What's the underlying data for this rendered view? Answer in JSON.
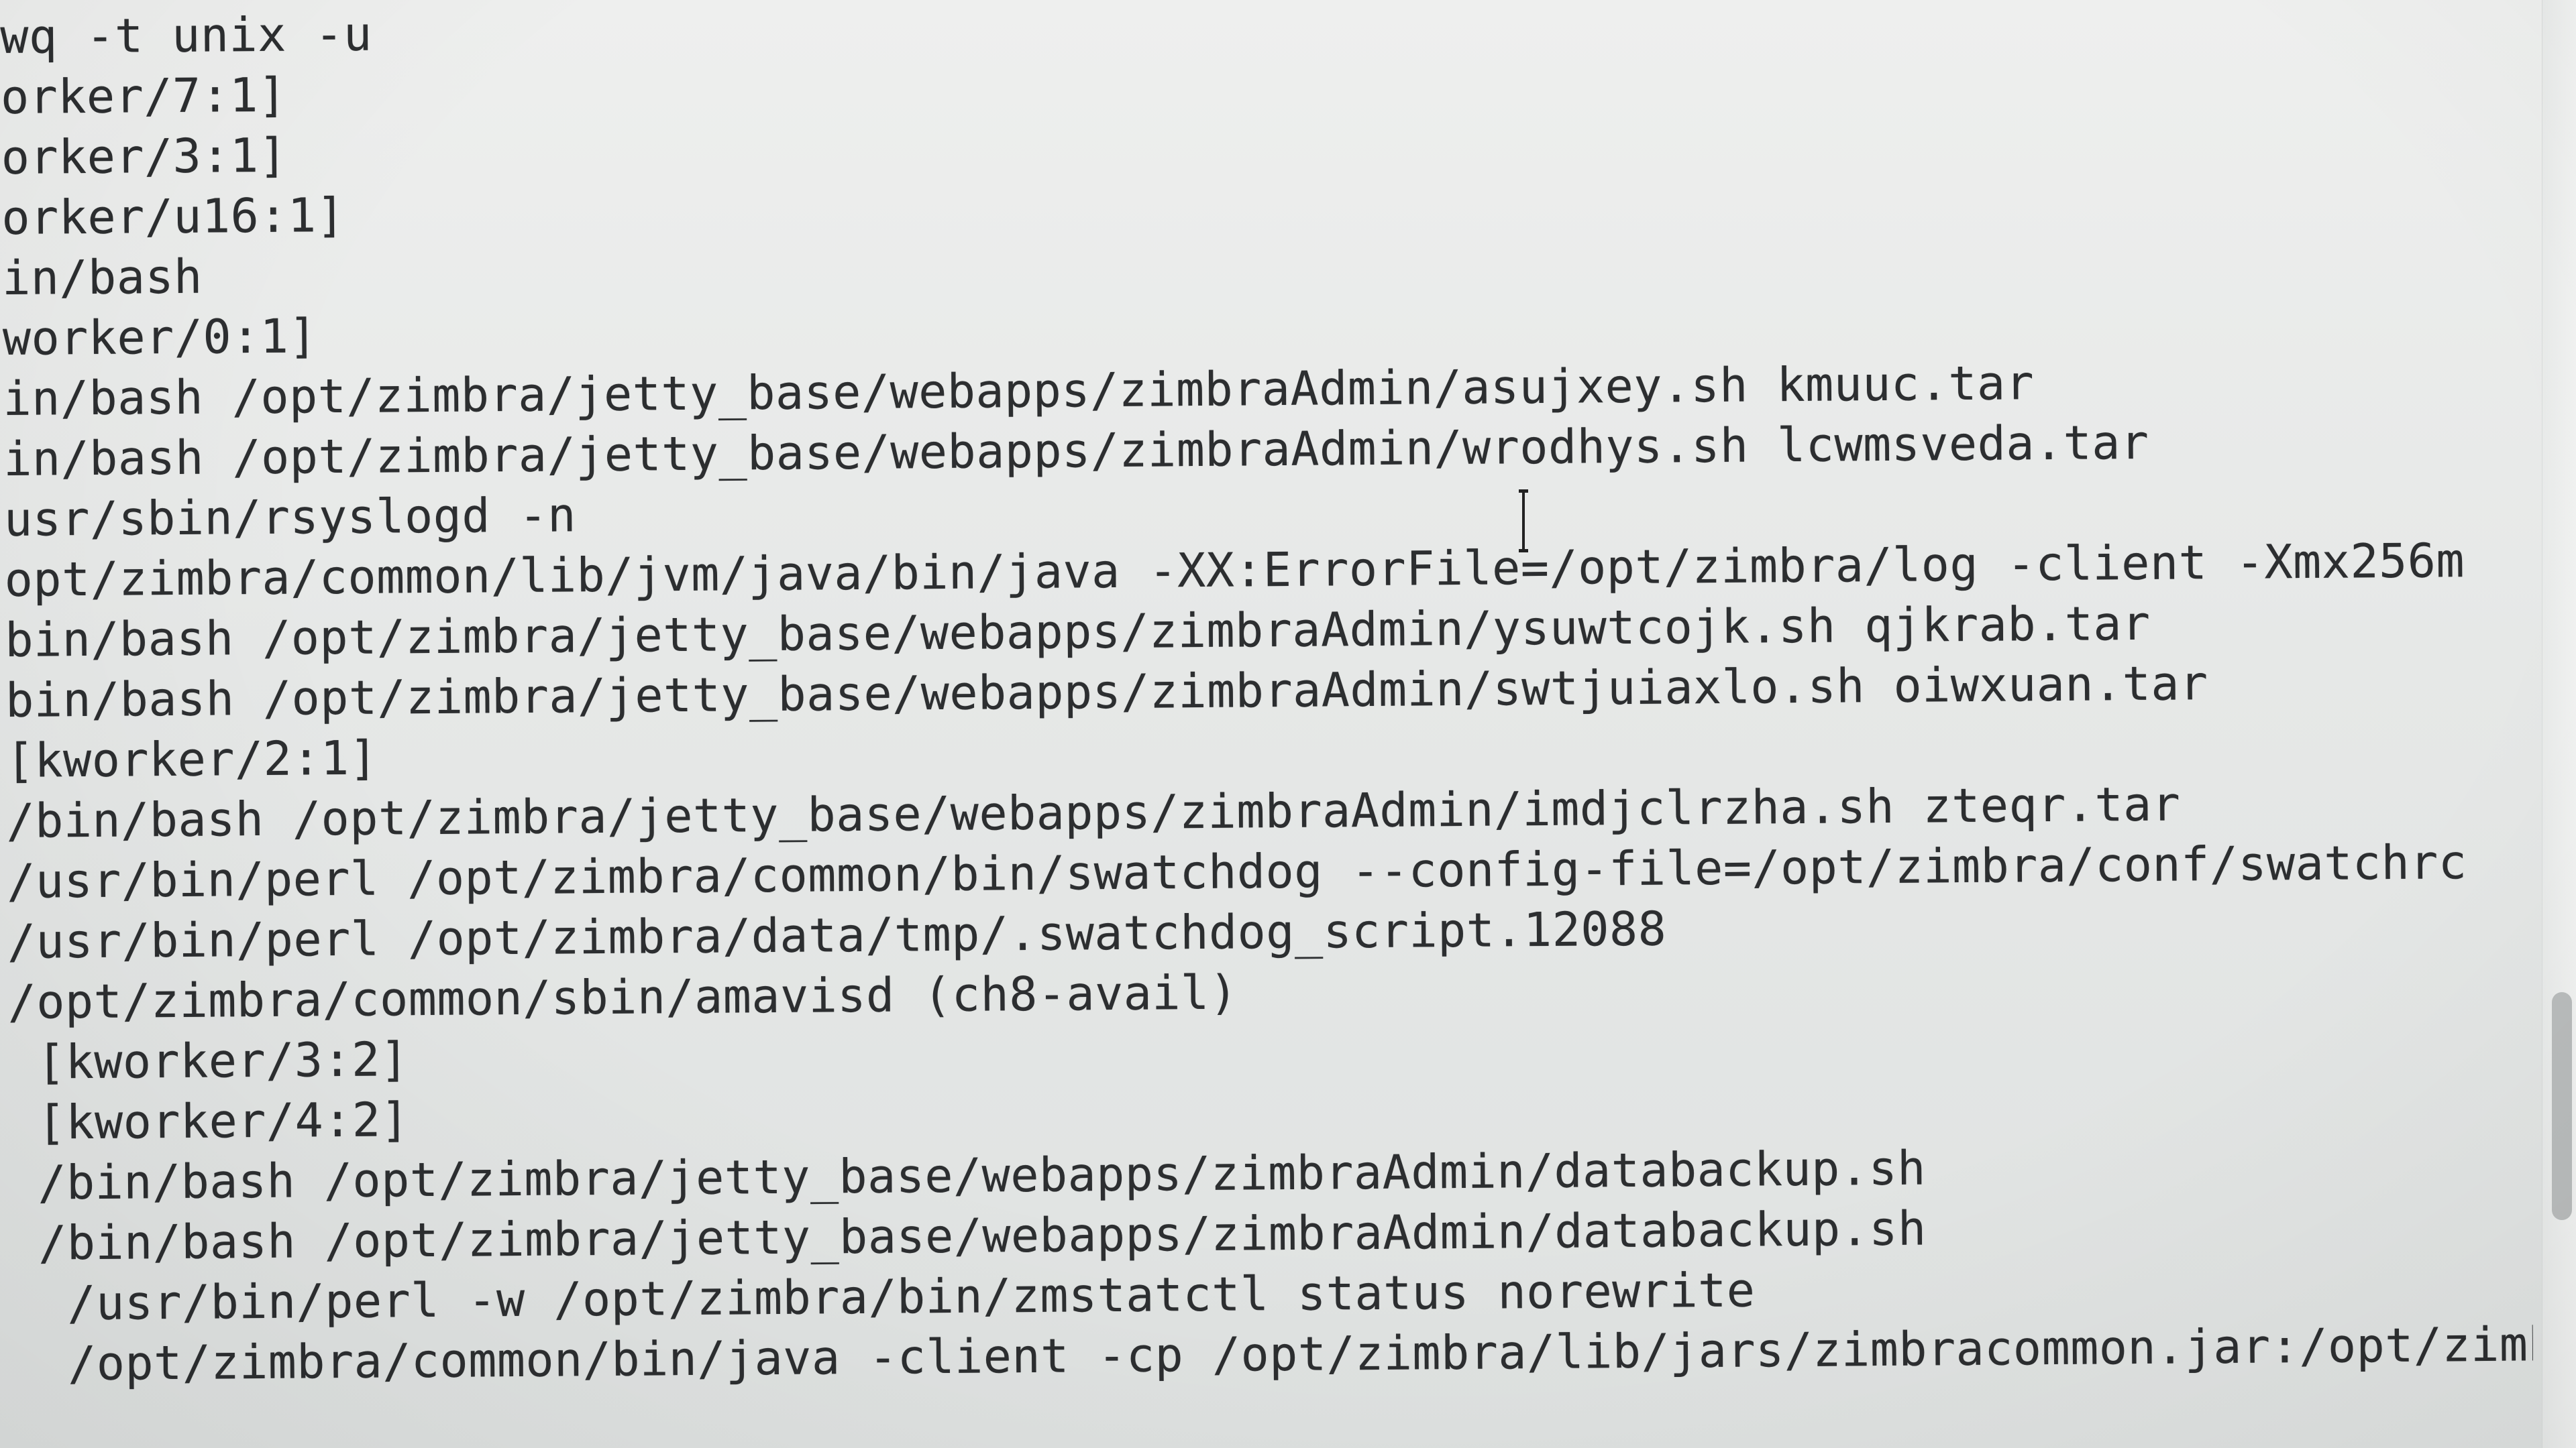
{
  "terminal": {
    "lines": [
      "wq -t unix -u",
      "orker/7:1]",
      "orker/3:1]",
      "orker/u16:1]",
      "in/bash",
      "worker/0:1]",
      "in/bash /opt/zimbra/jetty_base/webapps/zimbraAdmin/asujxey.sh kmuuc.tar",
      "in/bash /opt/zimbra/jetty_base/webapps/zimbraAdmin/wrodhys.sh lcwmsveda.tar",
      "usr/sbin/rsyslogd -n",
      "opt/zimbra/common/lib/jvm/java/bin/java -XX:ErrorFile=/opt/zimbra/log -client -Xmx256m",
      "bin/bash /opt/zimbra/jetty_base/webapps/zimbraAdmin/ysuwtcojk.sh qjkrab.tar",
      "bin/bash /opt/zimbra/jetty_base/webapps/zimbraAdmin/swtjuiaxlo.sh oiwxuan.tar",
      "[kworker/2:1]",
      "/bin/bash /opt/zimbra/jetty_base/webapps/zimbraAdmin/imdjclrzha.sh zteqr.tar",
      "/usr/bin/perl /opt/zimbra/common/bin/swatchdog --config-file=/opt/zimbra/conf/swatchrc",
      "/usr/bin/perl /opt/zimbra/data/tmp/.swatchdog_script.12088",
      "/opt/zimbra/common/sbin/amavisd (ch8-avail)",
      " [kworker/3:2]",
      " [kworker/4:2]",
      " /bin/bash /opt/zimbra/jetty_base/webapps/zimbraAdmin/databackup.sh",
      " /bin/bash /opt/zimbra/jetty_base/webapps/zimbraAdmin/databackup.sh",
      "  /usr/bin/perl -w /opt/zimbra/bin/zmstatctl status norewrite",
      "  /opt/zimbra/common/bin/java -client -cp /opt/zimbra/lib/jars/zimbracommon.jar:/opt/zimb"
    ]
  }
}
